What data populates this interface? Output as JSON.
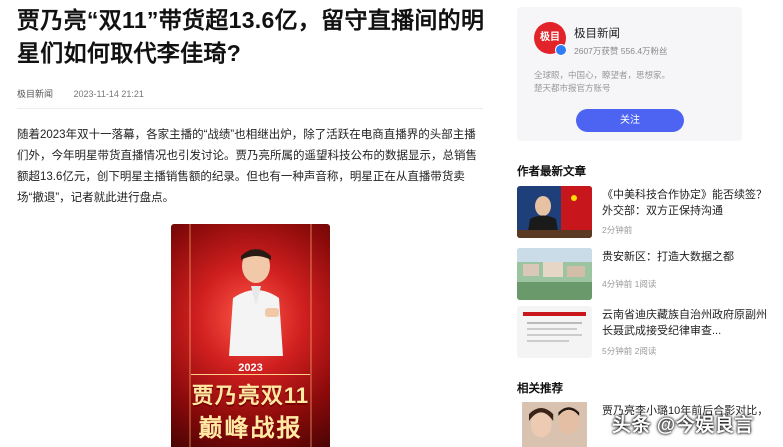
{
  "article": {
    "title": "贾乃亮“双11”带货超13.6亿，留守直播间的明星们如何取代李佳琦?",
    "source": "极目新闻",
    "date": "2023-11-14 21:21",
    "body": "随着2023年双十一落幕，各家主播的“战绩”也相继出炉，除了活跃在电商直播界的头部主播们外，今年明星带货直播情况也引发讨论。贾乃亮所属的遥望科技公布的数据显示，总销售额超13.6亿元，创下明星主播销售额的纪录。但也有一种声音称，明星正在从直播带货卖场“撤退”，记者就此进行盘点。",
    "poster": {
      "year": "2023",
      "line1": "贾乃亮双11",
      "line2": "巅峰战报"
    }
  },
  "author_card": {
    "logo_text": "极目",
    "name": "极目新闻",
    "stats": "2607万获赞 556.4万粉丝",
    "desc_line1": "全球眼，中国心，瞭望者，思想家。",
    "desc_line2": "楚天都市报官方账号",
    "follow_label": "关注"
  },
  "latest": {
    "heading": "作者最新文章",
    "items": [
      {
        "title": "《中美科技合作协定》能否续签？外交部：双方正保持沟通",
        "time": "2分钟前"
      },
      {
        "title": "贵安新区：打造大数据之都",
        "time": "4分钟前 1阅读"
      },
      {
        "title": "云南省迪庆藏族自治州政府原副州长聂武成接受纪律审查...",
        "time": "5分钟前 2阅读"
      }
    ]
  },
  "related": {
    "heading": "相关推荐",
    "items": [
      {
        "title": "贾乃亮李小璐10年前后合影对比，",
        "time": ""
      }
    ]
  },
  "watermark": "头条 @今娱良言",
  "colors": {
    "accent": "#4d64f2",
    "brand_red": "#e3232a"
  }
}
